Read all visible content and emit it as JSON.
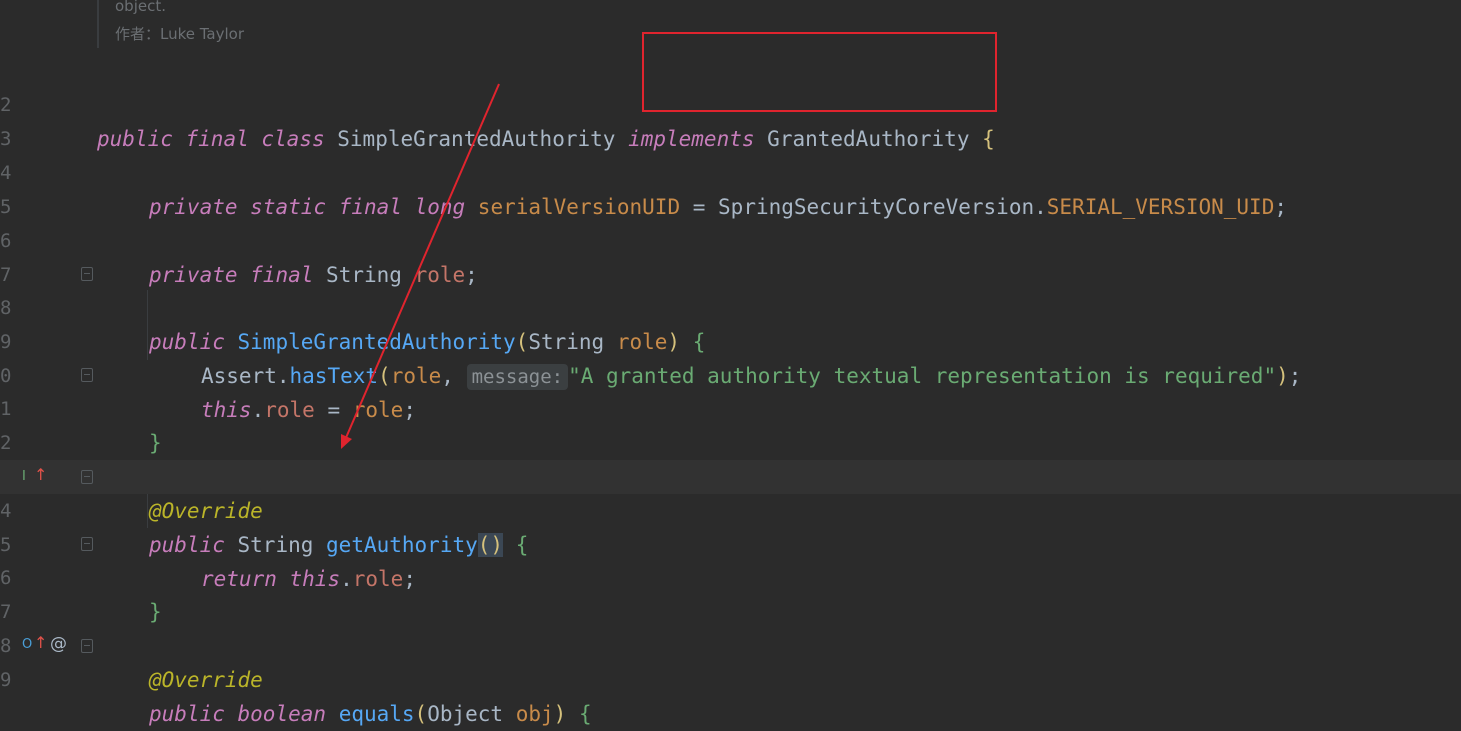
{
  "doc": {
    "line1": "object.",
    "author": "作者：Luke Taylor"
  },
  "lines": [
    {
      "num": "2",
      "kw1": "public",
      "kw2": "final",
      "kw3": "class",
      "name": "SimpleGrantedAuthority",
      "kw4": "implements",
      "iface": "GrantedAuthority",
      "brace": "{"
    },
    {
      "num": "3"
    },
    {
      "num": "4",
      "kw1": "private",
      "kw2": "static",
      "kw3": "final",
      "kw4": "long",
      "field": "serialVersionUID",
      "eq": " = ",
      "cls": "SpringSecurityCoreVersion",
      "dot": ".",
      "const": "SERIAL_VERSION_UID",
      "semi": ";"
    },
    {
      "num": "5"
    },
    {
      "num": "6",
      "kw1": "private",
      "kw2": "final",
      "type": "String",
      "field": "role",
      "semi": ";"
    },
    {
      "num": "7"
    },
    {
      "num": "8",
      "kw1": "public",
      "fn": "SimpleGrantedAuthority",
      "open": "(",
      "type": "String",
      "param": "role",
      "close": ")",
      "brace": "{"
    },
    {
      "num": "9",
      "cls": "Assert",
      "dot": ".",
      "fn": "hasText",
      "open": "(",
      "param": "role",
      "comma": ", ",
      "hint": "message:",
      "str": "\"A granted authority textual representation is required\"",
      "close": ")",
      "semi": ";"
    },
    {
      "num": "0",
      "kw": "this",
      "dot": ".",
      "field": "role",
      "eq": " = ",
      "param": "role",
      "semi": ";"
    },
    {
      "num": "1",
      "brace": "}"
    },
    {
      "num": "2"
    },
    {
      "num": "3",
      "ann": "@Override"
    },
    {
      "num": "4",
      "kw1": "public",
      "type": "String",
      "fn": "getAuthority",
      "parens": "()",
      "brace": "{"
    },
    {
      "num": "5",
      "kw1": "return",
      "kw2": "this",
      "dot": ".",
      "field": "role",
      "semi": ";"
    },
    {
      "num": "6",
      "brace": "}"
    },
    {
      "num": "7"
    },
    {
      "num": "8",
      "ann": "@Override"
    },
    {
      "num": "9",
      "kw1": "public",
      "kw2": "boolean",
      "fn": "equals",
      "open": "(",
      "type": "Object",
      "param": "obj",
      "close": ")",
      "brace": "{"
    }
  ],
  "gutter_icons": {
    "impl_icon": "I",
    "override_arrow": "↑",
    "at_icon": "@",
    "o_icon": "O"
  },
  "colors": {
    "background": "#2b2b2b",
    "annotation_box": "#e0242e",
    "arrow": "#e0242e"
  }
}
